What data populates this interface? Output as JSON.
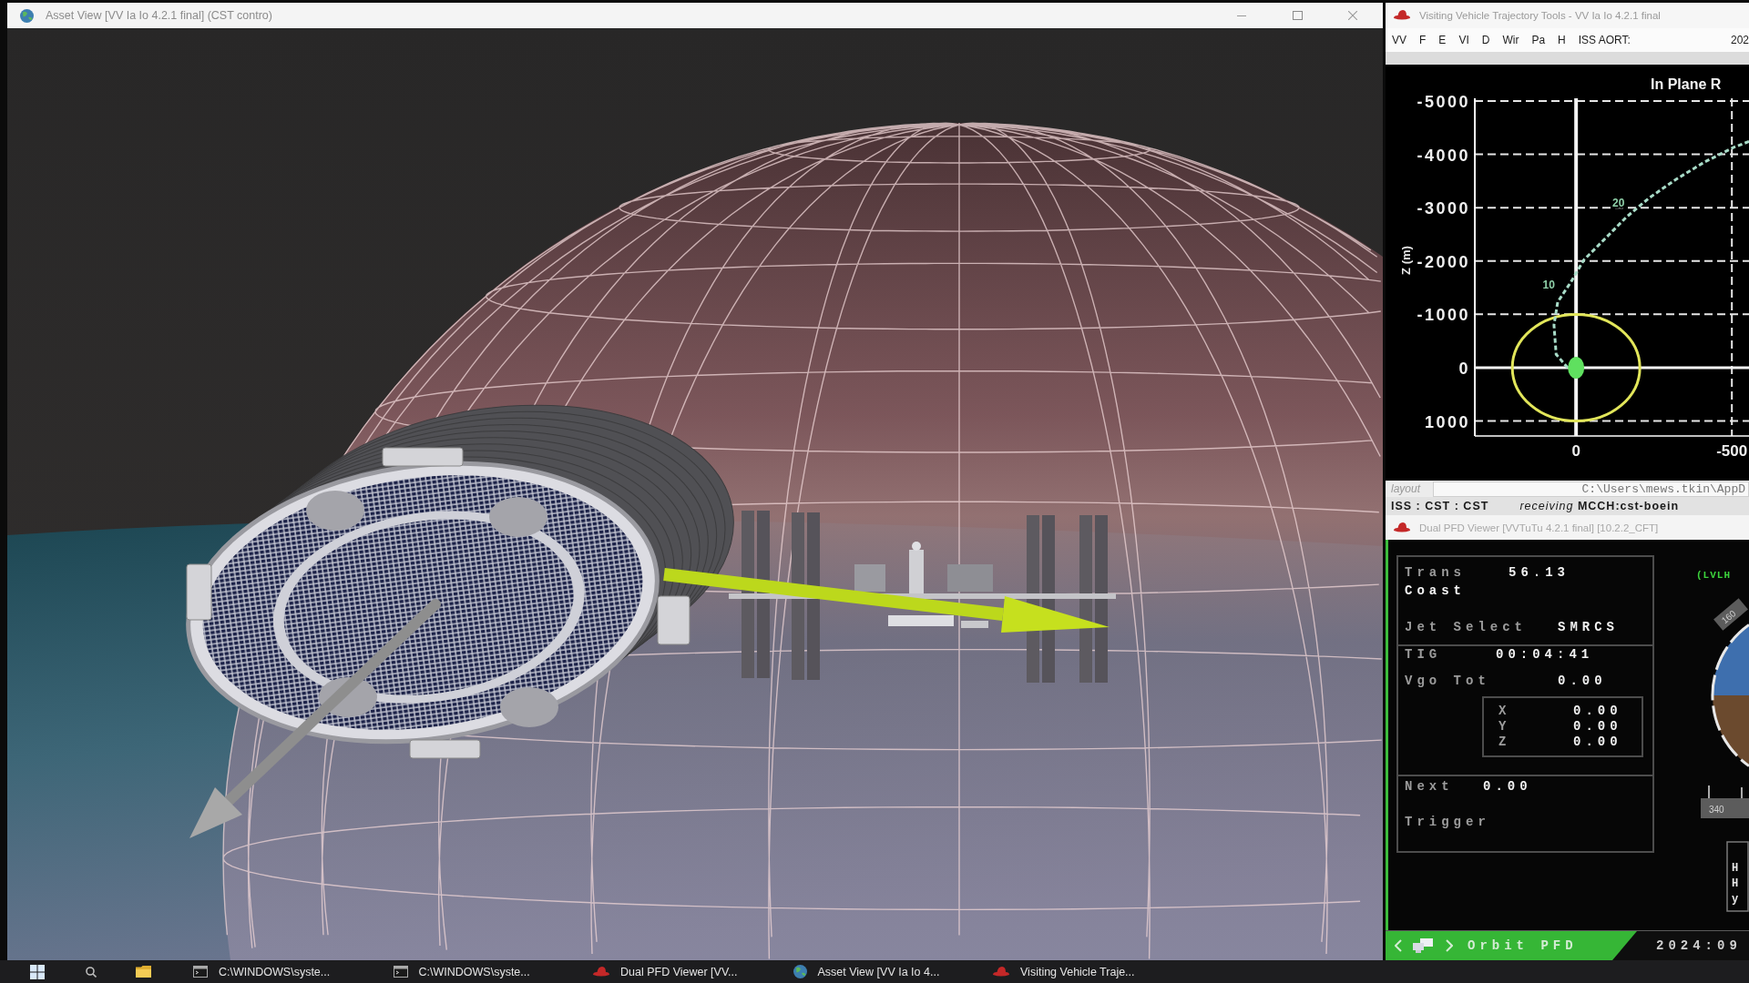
{
  "asset_view": {
    "title": "Asset View [VV Ia Io 4.2.1 final] (CST contro)"
  },
  "trajectory_tools": {
    "title": "Visiting Vehicle Trajectory Tools - VV Ia Io 4.2.1 final",
    "menu": [
      "VV",
      "F",
      "E",
      "VI",
      "D",
      "Wir",
      "Pa",
      "H",
      "ISS AORT:"
    ],
    "date": "202",
    "chart_data": {
      "type": "line",
      "title": "In Plane R",
      "ylabel": "Z (m)",
      "grid": true,
      "x": [
        27,
        64,
        71,
        59,
        41,
        17,
        -25,
        -88,
        -161,
        -183,
        -234,
        -318,
        -411,
        -506,
        -555,
        0
      ],
      "series": [
        {
          "color": "#a8dcc8",
          "line_style": "dotted",
          "values": [
            0,
            -250,
            -800,
            -1230,
            -1390,
            -1600,
            -2020,
            -2390,
            -2820,
            -2930,
            -3180,
            -3520,
            -3850,
            -4130,
            -4240,
            null
          ]
        },
        {
          "color": "#5fe05f",
          "marker": "circle",
          "values": [
            null,
            null,
            null,
            null,
            null,
            null,
            null,
            null,
            null,
            null,
            null,
            null,
            null,
            null,
            null,
            0
          ]
        }
      ],
      "xlim": [
        325,
        -555
      ],
      "ylim": [
        1280,
        -5050
      ],
      "xticks": [
        0,
        -500
      ],
      "yticks": [
        -5000,
        -4000,
        -3000,
        -2000,
        -1000,
        0,
        1000
      ],
      "annotations": [
        {
          "x": 41,
          "y": -1390,
          "text": "10"
        },
        {
          "x": -183,
          "y": -2930,
          "text": "20"
        }
      ]
    },
    "layout": {
      "label": "layout",
      "path": "C:\\Users\\mews.tkin\\AppD"
    },
    "status": {
      "link": "ISS : CST : CST",
      "connection": "*receiving* **MCCH:cst-boein**"
    }
  },
  "pfd": {
    "title": "Dual PFD Viewer [VVTuTu 4.2.1 final] [10.2.2_CFT]",
    "sections": [
      {
        "rows": [
          {
            "kind": "pair",
            "label": "Trans",
            "value": "56.13"
          },
          {
            "kind": "mode",
            "label": "Coast"
          },
          {
            "kind": "pair",
            "label": "Jet Select",
            "value": "SMRCS"
          }
        ]
      },
      {
        "rows": [
          {
            "kind": "pair",
            "label": "TIG",
            "value": "00:04:41"
          },
          {
            "kind": "pair",
            "label": "Vgo Tot",
            "value": "0.00"
          },
          {
            "kind": "vector",
            "components": [
              {
                "axis": "X",
                "value": "0.00"
              },
              {
                "axis": "Y",
                "value": "0.00"
              },
              {
                "axis": "Z",
                "value": "0.00"
              }
            ]
          }
        ]
      },
      {
        "rows": [
          {
            "kind": "pair",
            "label": "Next",
            "value": "0.00"
          },
          {
            "kind": "label",
            "label": "Trigger"
          }
        ]
      }
    ],
    "frame_label": "(LVLH",
    "tape_marks": [
      "160",
      "340"
    ],
    "readouts": [
      "H",
      "H",
      "y"
    ],
    "footer": {
      "page": "Orbit PFD",
      "date": "2024:09"
    }
  },
  "taskbar": {
    "items": [
      {
        "kind": "console",
        "label": "C:\\WINDOWS\\syste..."
      },
      {
        "kind": "console",
        "label": "C:\\WINDOWS\\syste..."
      },
      {
        "kind": "app",
        "label": "Dual PFD Viewer [VV..."
      },
      {
        "kind": "globe",
        "label": "Asset View [VV Ia Io 4..."
      },
      {
        "kind": "app",
        "label": "Visiting Vehicle Traje..."
      }
    ]
  }
}
